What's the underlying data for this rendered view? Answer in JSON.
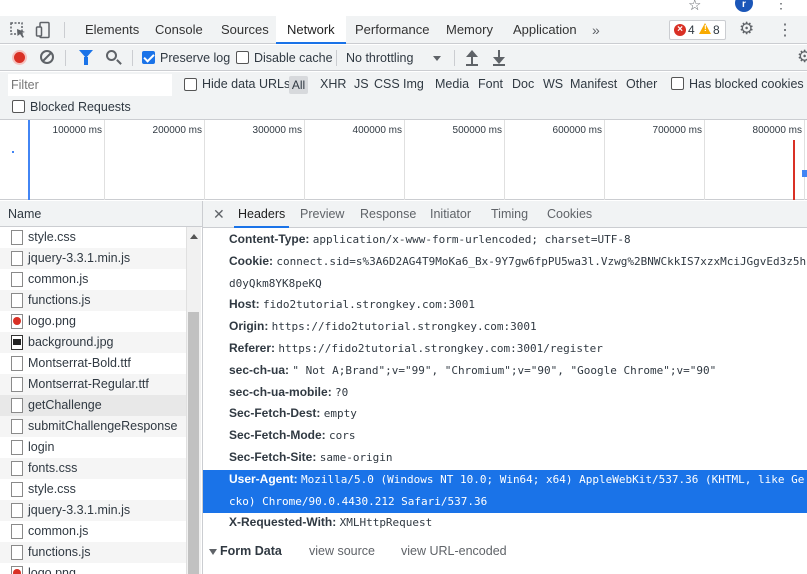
{
  "devtools": {
    "tabs": [
      "Elements",
      "Console",
      "Sources",
      "Network",
      "Performance",
      "Memory",
      "Application"
    ],
    "active_tab": "Network",
    "more_tabs": "»",
    "error_count": "4",
    "warning_count": "8",
    "avatar_initial": "r"
  },
  "toolbar": {
    "preserve_log": "Preserve log",
    "disable_cache": "Disable cache",
    "throttling": "No throttling",
    "preserve_log_checked": true,
    "disable_cache_checked": false
  },
  "filter": {
    "placeholder": "Filter",
    "hide_data_urls": "Hide data URLs",
    "all": "All",
    "types": [
      "XHR",
      "JS",
      "CSS",
      "Img",
      "Media",
      "Font",
      "Doc",
      "WS",
      "Manifest",
      "Other"
    ],
    "has_blocked_cookies": "Has blocked cookies",
    "blocked_requests": "Blocked Requests"
  },
  "overview": {
    "ticks": [
      "100000 ms",
      "200000 ms",
      "300000 ms",
      "400000 ms",
      "500000 ms",
      "600000 ms",
      "700000 ms",
      "800000 ms"
    ]
  },
  "requests": {
    "header": "Name",
    "items": [
      {
        "name": "style.css",
        "icon": "file"
      },
      {
        "name": "jquery-3.3.1.min.js",
        "icon": "file"
      },
      {
        "name": "common.js",
        "icon": "file"
      },
      {
        "name": "functions.js",
        "icon": "file"
      },
      {
        "name": "logo.png",
        "icon": "image-red"
      },
      {
        "name": "background.jpg",
        "icon": "image-dark"
      },
      {
        "name": "Montserrat-Bold.ttf",
        "icon": "file"
      },
      {
        "name": "Montserrat-Regular.ttf",
        "icon": "file"
      },
      {
        "name": "getChallenge",
        "icon": "file"
      },
      {
        "name": "submitChallengeResponse",
        "icon": "file"
      },
      {
        "name": "login",
        "icon": "file"
      },
      {
        "name": "fonts.css",
        "icon": "file"
      },
      {
        "name": "style.css",
        "icon": "file"
      },
      {
        "name": "jquery-3.3.1.min.js",
        "icon": "file"
      },
      {
        "name": "common.js",
        "icon": "file"
      },
      {
        "name": "functions.js",
        "icon": "file"
      },
      {
        "name": "logo.png",
        "icon": "image-red"
      }
    ],
    "selected": "getChallenge"
  },
  "details": {
    "tabs": [
      "Headers",
      "Preview",
      "Response",
      "Initiator",
      "Timing",
      "Cookies"
    ],
    "active_tab": "Headers",
    "headers": [
      {
        "key": "Content-Type:",
        "value": "application/x-www-form-urlencoded; charset=UTF-8"
      },
      {
        "key": "Cookie:",
        "value": "connect.sid=s%3A6D2AG4T9MoKa6_Bx-9Y7gw6fpPU5wa3l.Vzwg%2BNWCkkIS7xzxMciJGgvEd3z5h"
      },
      {
        "key": "",
        "value": "d0yQkm8YK8peKQ"
      },
      {
        "key": "Host:",
        "value": "fido2tutorial.strongkey.com:3001"
      },
      {
        "key": "Origin:",
        "value": "https://fido2tutorial.strongkey.com:3001"
      },
      {
        "key": "Referer:",
        "value": "https://fido2tutorial.strongkey.com:3001/register"
      },
      {
        "key": "sec-ch-ua:",
        "value": "\" Not A;Brand\";v=\"99\", \"Chromium\";v=\"90\", \"Google Chrome\";v=\"90\""
      },
      {
        "key": "sec-ch-ua-mobile:",
        "value": "?0"
      },
      {
        "key": "Sec-Fetch-Dest:",
        "value": "empty"
      },
      {
        "key": "Sec-Fetch-Mode:",
        "value": "cors"
      },
      {
        "key": "Sec-Fetch-Site:",
        "value": "same-origin"
      },
      {
        "key": "User-Agent:",
        "value": "Mozilla/5.0 (Windows NT 10.0; Win64; x64) AppleWebKit/537.36 (KHTML, like Ge"
      },
      {
        "key": "",
        "value": "cko) Chrome/90.0.4430.212 Safari/537.36"
      },
      {
        "key": "X-Requested-With:",
        "value": "XMLHttpRequest"
      }
    ],
    "form_data": {
      "title": "Form Data",
      "view_source": "view source",
      "view_url_encoded": "view URL-encoded"
    }
  },
  "colors": {
    "accent": "#1a73e8",
    "record": "#d93025",
    "toolbar_bg": "#f1f3f4"
  }
}
